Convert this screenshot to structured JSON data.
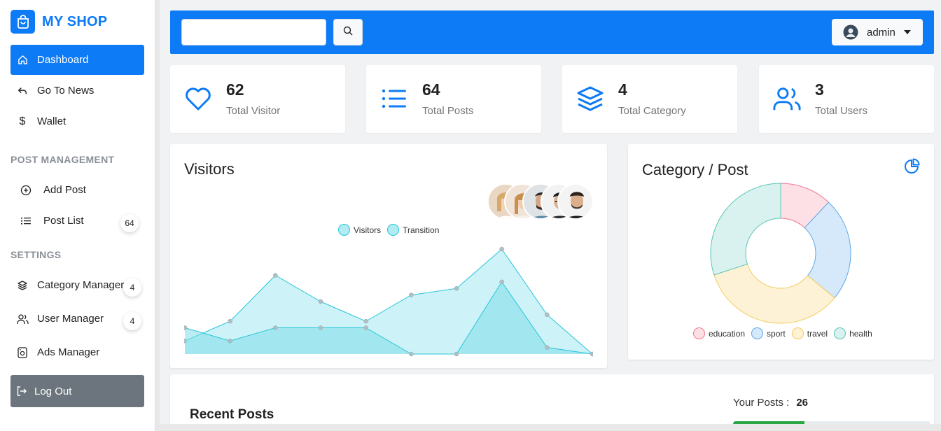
{
  "brand": {
    "name": "MY SHOP"
  },
  "sidebar": {
    "items": [
      {
        "label": "Dashboard",
        "icon": "home-icon"
      },
      {
        "label": "Go To News",
        "icon": "return-arrow-icon"
      },
      {
        "label": "Wallet",
        "icon": "dollar-icon"
      }
    ],
    "post_section": "POST MANAGEMENT",
    "post_items": [
      {
        "label": "Add Post",
        "icon": "plus-circle-icon"
      },
      {
        "label": "Post List",
        "icon": "list-icon",
        "badge": "64"
      }
    ],
    "settings_section": "SETTINGS",
    "settings_items": [
      {
        "label": "Category Manager",
        "icon": "layers-icon",
        "badge": "4"
      },
      {
        "label": "User Manager",
        "icon": "users-icon",
        "badge": "4"
      },
      {
        "label": "Ads Manager",
        "icon": "ads-icon"
      }
    ],
    "logout": "Log Out"
  },
  "header": {
    "search_value": "",
    "user": "admin"
  },
  "stats": [
    {
      "value": "62",
      "label": "Total Visitor",
      "icon": "heart-icon"
    },
    {
      "value": "64",
      "label": "Total Posts",
      "icon": "list-icon"
    },
    {
      "value": "4",
      "label": "Total Category",
      "icon": "layers-icon"
    },
    {
      "value": "3",
      "label": "Total Users",
      "icon": "users-icon"
    }
  ],
  "visitors_panel": {
    "title": "Visitors",
    "legend": [
      "Visitors",
      "Transition"
    ]
  },
  "category_panel": {
    "title": "Category / Post",
    "legend": [
      "education",
      "sport",
      "travel",
      "health"
    ]
  },
  "recent": {
    "title": "Recent Posts",
    "your_posts_label": "Your Posts :",
    "your_posts_value": "26",
    "progress": 0.36
  },
  "colors": {
    "primary": "#0d7bf5",
    "visitors_fill": "#b2ebf2",
    "transition_fill": "#80deea",
    "education": "#fde0e6",
    "sport": "#d6e9fb",
    "travel": "#fdf2d6",
    "health": "#d9f2ef"
  },
  "chart_data": [
    {
      "type": "area",
      "categories": [
        "1",
        "2",
        "3",
        "4",
        "5",
        "6",
        "7",
        "8",
        "9",
        "10"
      ],
      "series": [
        {
          "name": "Visitors",
          "values": [
            2,
            5,
            12,
            8,
            5,
            9,
            10,
            16,
            6,
            0
          ]
        },
        {
          "name": "Transition",
          "values": [
            4,
            2,
            4,
            4,
            4,
            0,
            0,
            11,
            1,
            0
          ]
        }
      ],
      "ylim": [
        0,
        16
      ],
      "legend": "top-center"
    },
    {
      "type": "pie",
      "donut": true,
      "labels": [
        "education",
        "sport",
        "travel",
        "health"
      ],
      "values": [
        12,
        24,
        34,
        30
      ],
      "legend": "bottom"
    }
  ]
}
